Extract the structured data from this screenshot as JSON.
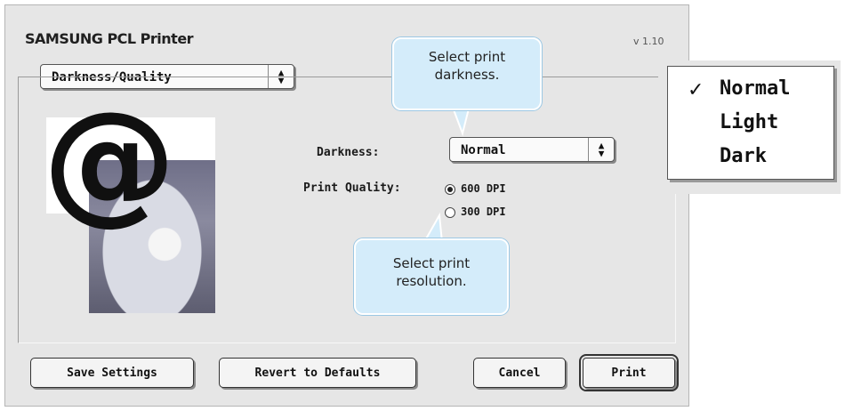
{
  "dialog": {
    "title": "SAMSUNG PCL Printer",
    "version": "v 1.10",
    "panel_select": "Darkness/Quality",
    "darkness_label": "Darkness:",
    "darkness_value": "Normal",
    "quality_label": "Print Quality:",
    "quality_options": [
      {
        "label": "600 DPI",
        "selected": true
      },
      {
        "label": "300 DPI",
        "selected": false
      }
    ],
    "preview_symbol": "@",
    "buttons": {
      "save": "Save Settings",
      "revert": "Revert to Defaults",
      "cancel": "Cancel",
      "print": "Print"
    }
  },
  "callouts": {
    "darkness": "Select print darkness.",
    "darkness_line1": "Select print",
    "darkness_line2": "darkness.",
    "resolution_line1": "Select print",
    "resolution_line2": "resolution."
  },
  "darkness_menu": {
    "check": "✓",
    "items": [
      "Normal",
      "Light",
      "Dark"
    ],
    "selected": "Normal"
  },
  "colors": {
    "dialog_bg": "#e6e6e6",
    "callout_bg": "#d4ecfa"
  },
  "icons": [
    "up-down-arrows-icon",
    "checkmark-icon",
    "radio-selected-icon",
    "radio-empty-icon"
  ]
}
